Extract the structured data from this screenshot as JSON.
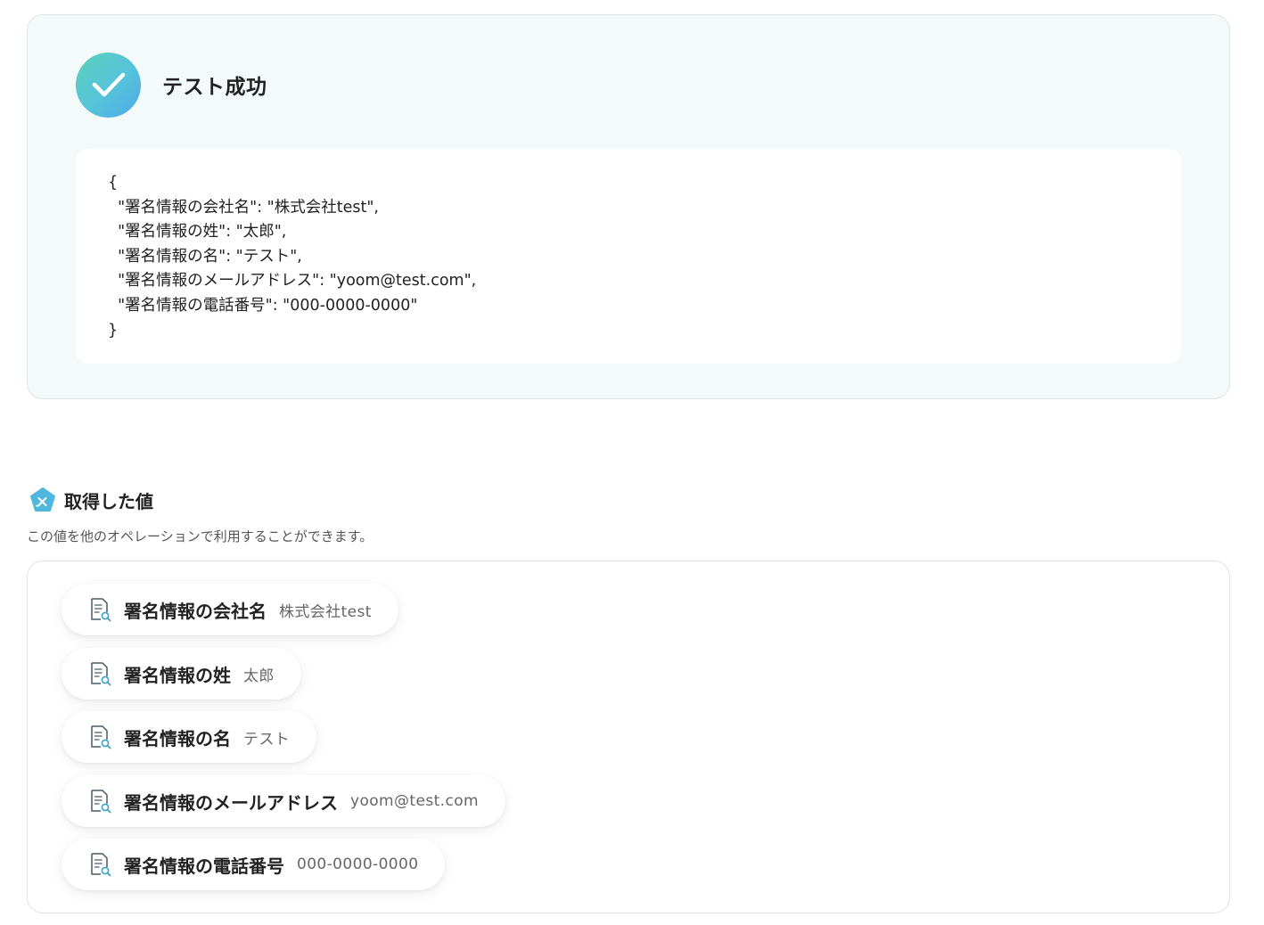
{
  "result": {
    "title": "テスト成功",
    "json_lines": [
      "{",
      "  \"署名情報の会社名\": \"株式会社test\",",
      "  \"署名情報の姓\": \"太郎\",",
      "  \"署名情報の名\": \"テスト\",",
      "  \"署名情報のメールアドレス\": \"yoom@test.com\",",
      "  \"署名情報の電話番号\": \"000-0000-0000\"",
      "}"
    ]
  },
  "values": {
    "title": "取得した値",
    "description": "この値を他のオペレーションで利用することができます。",
    "items": [
      {
        "label": "署名情報の会社名",
        "value": "株式会社test"
      },
      {
        "label": "署名情報の姓",
        "value": "太郎"
      },
      {
        "label": "署名情報の名",
        "value": "テスト"
      },
      {
        "label": "署名情報のメールアドレス",
        "value": "yoom@test.com"
      },
      {
        "label": "署名情報の電話番号",
        "value": "000-0000-0000"
      }
    ]
  },
  "colors": {
    "accent_teal": "#5ed1bd",
    "accent_blue": "#4fa9e6",
    "panel_bg": "#f4f9f9"
  },
  "icons": {
    "success": "check-icon",
    "values": "variable-pentagon-icon",
    "item": "document-search-icon"
  }
}
